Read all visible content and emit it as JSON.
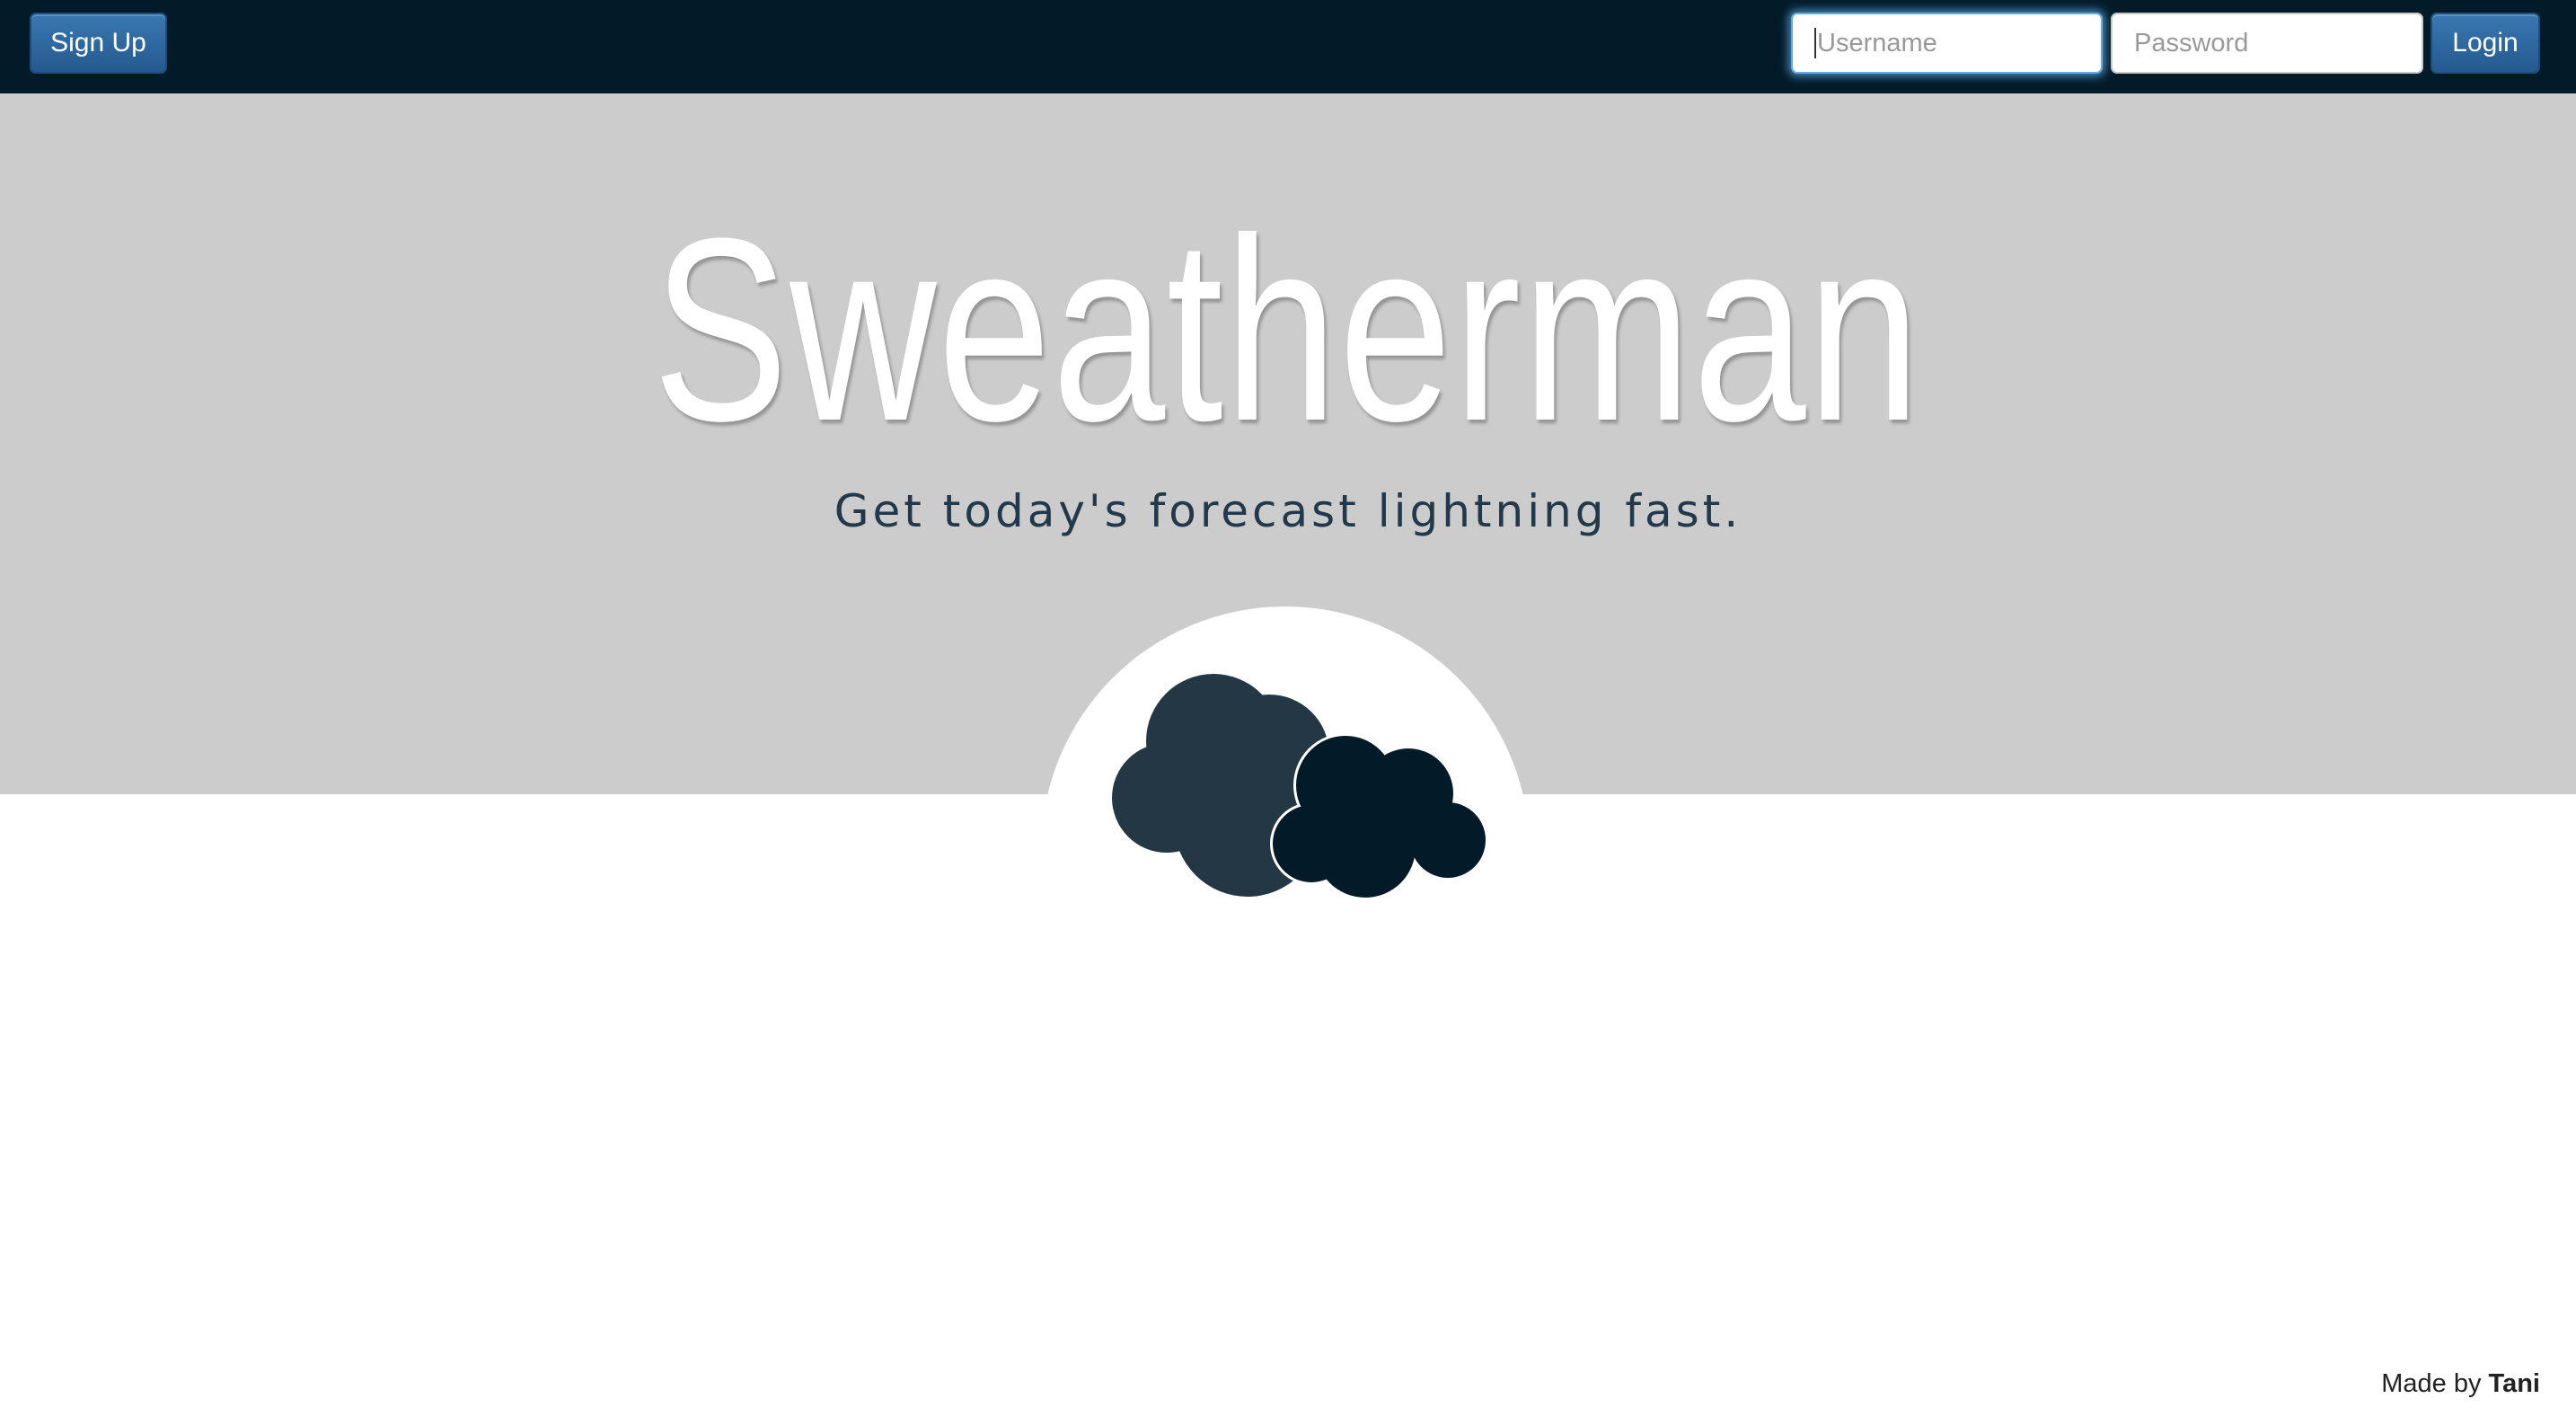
{
  "app": {
    "title": "Sweatherman",
    "tagline": "Get today's forecast lightning fast."
  },
  "navbar": {
    "signup_label": "Sign Up",
    "username_placeholder": "Username",
    "password_placeholder": "Password",
    "login_label": "Login"
  },
  "icons": {
    "logo": "clouds-icon"
  },
  "footer": {
    "prefix": "Made by",
    "author": "Tani"
  },
  "colors": {
    "navbar": "#031b29",
    "button": "#2b6399",
    "hero": "#cccccc",
    "cloud_back": "#233745",
    "cloud_front": "#031b29"
  }
}
